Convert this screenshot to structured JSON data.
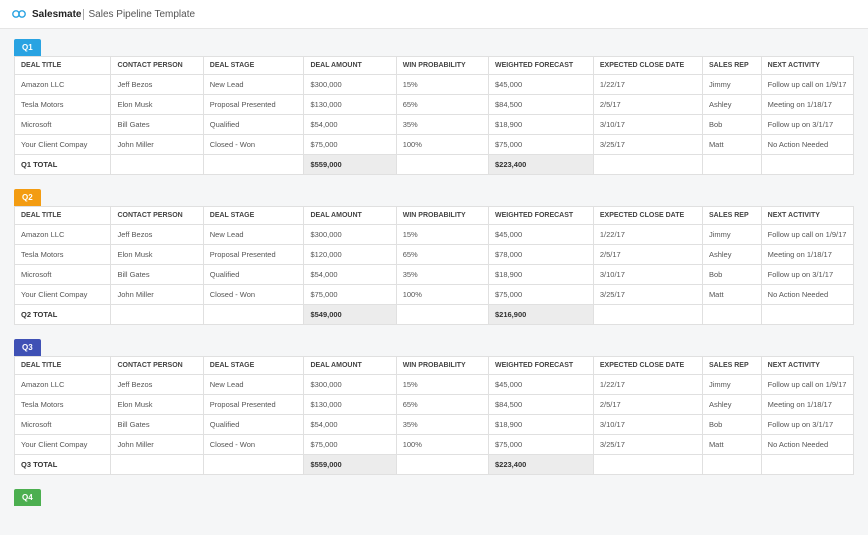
{
  "header": {
    "brand": "Salesmate",
    "subtitle": "Sales Pipeline Template"
  },
  "columns": [
    "DEAL TITLE",
    "CONTACT PERSON",
    "DEAL STAGE",
    "DEAL AMOUNT",
    "WIN PROBABILITY",
    "WEIGHTED FORECAST",
    "EXPECTED CLOSE DATE",
    "SALES REP",
    "NEXT ACTIVITY"
  ],
  "quarters": [
    {
      "id": "q1",
      "label": "Q1",
      "rows": [
        {
          "title": "Amazon LLC",
          "contact": "Jeff Bezos",
          "stage": "New Lead",
          "amount": "$300,000",
          "prob": "15%",
          "forecast": "$45,000",
          "close": "1/22/17",
          "rep": "Jimmy",
          "activity": "Follow up call on 1/9/17"
        },
        {
          "title": "Tesla Motors",
          "contact": "Elon Musk",
          "stage": "Proposal Presented",
          "amount": "$130,000",
          "prob": "65%",
          "forecast": "$84,500",
          "close": "2/5/17",
          "rep": "Ashley",
          "activity": "Meeting on 1/18/17"
        },
        {
          "title": "Microsoft",
          "contact": "Bill Gates",
          "stage": "Qualified",
          "amount": "$54,000",
          "prob": "35%",
          "forecast": "$18,900",
          "close": "3/10/17",
          "rep": "Bob",
          "activity": "Follow up on 3/1/17"
        },
        {
          "title": "Your Client Compay",
          "contact": "John Miller",
          "stage": "Closed - Won",
          "amount": "$75,000",
          "prob": "100%",
          "forecast": "$75,000",
          "close": "3/25/17",
          "rep": "Matt",
          "activity": "No Action Needed"
        }
      ],
      "total": {
        "label": "Q1 TOTAL",
        "amount": "$559,000",
        "forecast": "$223,400"
      }
    },
    {
      "id": "q2",
      "label": "Q2",
      "rows": [
        {
          "title": "Amazon LLC",
          "contact": "Jeff Bezos",
          "stage": "New Lead",
          "amount": "$300,000",
          "prob": "15%",
          "forecast": "$45,000",
          "close": "1/22/17",
          "rep": "Jimmy",
          "activity": "Follow up call on 1/9/17"
        },
        {
          "title": "Tesla Motors",
          "contact": "Elon Musk",
          "stage": "Proposal Presented",
          "amount": "$120,000",
          "prob": "65%",
          "forecast": "$78,000",
          "close": "2/5/17",
          "rep": "Ashley",
          "activity": "Meeting on 1/18/17"
        },
        {
          "title": "Microsoft",
          "contact": "Bill Gates",
          "stage": "Qualified",
          "amount": "$54,000",
          "prob": "35%",
          "forecast": "$18,900",
          "close": "3/10/17",
          "rep": "Bob",
          "activity": "Follow up on 3/1/17"
        },
        {
          "title": "Your Client Compay",
          "contact": "John Miller",
          "stage": "Closed - Won",
          "amount": "$75,000",
          "prob": "100%",
          "forecast": "$75,000",
          "close": "3/25/17",
          "rep": "Matt",
          "activity": "No Action Needed"
        }
      ],
      "total": {
        "label": "Q2 TOTAL",
        "amount": "$549,000",
        "forecast": "$216,900"
      }
    },
    {
      "id": "q3",
      "label": "Q3",
      "rows": [
        {
          "title": "Amazon LLC",
          "contact": "Jeff Bezos",
          "stage": "New Lead",
          "amount": "$300,000",
          "prob": "15%",
          "forecast": "$45,000",
          "close": "1/22/17",
          "rep": "Jimmy",
          "activity": "Follow up call on 1/9/17"
        },
        {
          "title": "Tesla Motors",
          "contact": "Elon Musk",
          "stage": "Proposal Presented",
          "amount": "$130,000",
          "prob": "65%",
          "forecast": "$84,500",
          "close": "2/5/17",
          "rep": "Ashley",
          "activity": "Meeting on 1/18/17"
        },
        {
          "title": "Microsoft",
          "contact": "Bill Gates",
          "stage": "Qualified",
          "amount": "$54,000",
          "prob": "35%",
          "forecast": "$18,900",
          "close": "3/10/17",
          "rep": "Bob",
          "activity": "Follow up on 3/1/17"
        },
        {
          "title": "Your Client Compay",
          "contact": "John Miller",
          "stage": "Closed - Won",
          "amount": "$75,000",
          "prob": "100%",
          "forecast": "$75,000",
          "close": "3/25/17",
          "rep": "Matt",
          "activity": "No Action Needed"
        }
      ],
      "total": {
        "label": "Q3 TOTAL",
        "amount": "$559,000",
        "forecast": "$223,400"
      }
    },
    {
      "id": "q4",
      "label": "Q4",
      "rows": [],
      "total": null
    }
  ]
}
